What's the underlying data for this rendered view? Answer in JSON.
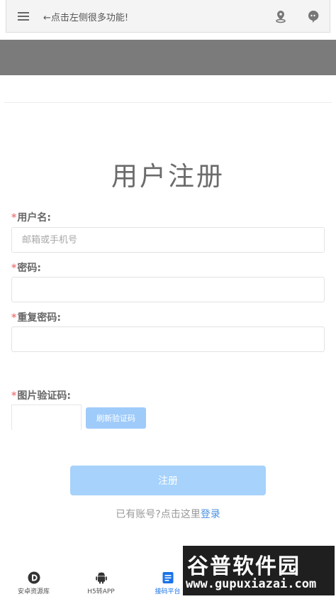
{
  "topbar": {
    "hint": "←点击左侧很多功能!"
  },
  "form": {
    "title": "用户注册",
    "required_mark": "*",
    "username": {
      "label": "用户名:",
      "placeholder": "邮箱或手机号",
      "value": ""
    },
    "password": {
      "label": "密码:",
      "value": ""
    },
    "password_confirm": {
      "label": "重复密码:",
      "value": ""
    },
    "captcha": {
      "label": "图片验证码:",
      "refresh_label": "刷新验证码"
    },
    "submit_label": "注册",
    "login_prompt": "已有账号?点击这里",
    "login_link": "登录"
  },
  "bottom_nav": {
    "items": [
      {
        "label": "安卓资源库",
        "icon": "d-logo-icon"
      },
      {
        "label": "H5转APP",
        "icon": "android-icon"
      },
      {
        "label": "接码平台",
        "icon": "document-icon",
        "active": true
      }
    ]
  },
  "watermark": {
    "brand": "谷普软件园",
    "domain": "www.gupuxiazai.com"
  },
  "colors": {
    "accent": "#1a73e8",
    "button": "#a6d2fb",
    "required": "#f08080"
  }
}
